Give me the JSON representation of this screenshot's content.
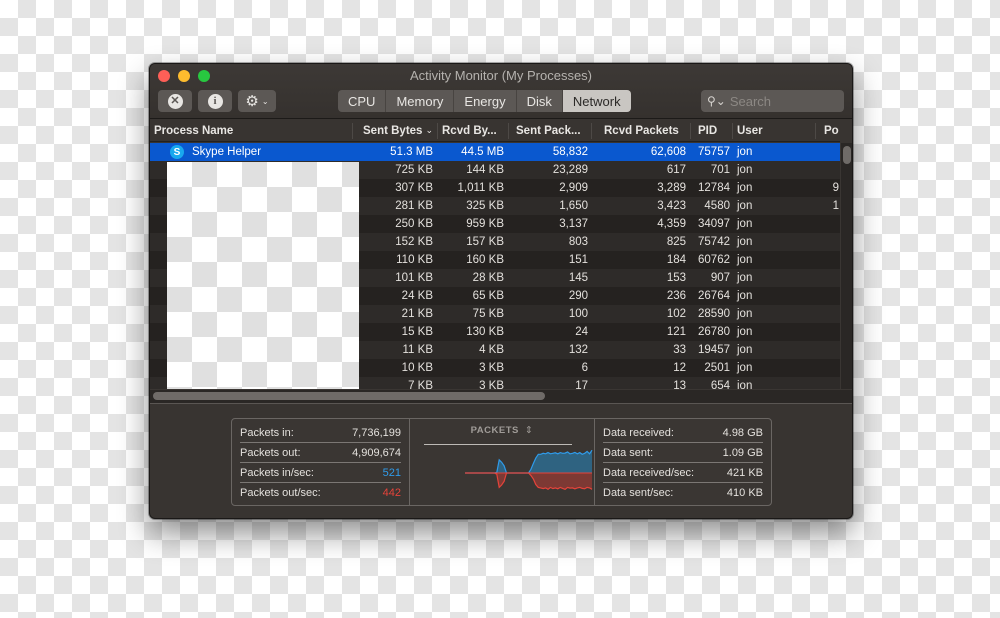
{
  "window": {
    "title": "Activity Monitor (My Processes)"
  },
  "toolbar": {
    "stop_icon": "stop-process-icon",
    "info_icon": "info-icon",
    "gear_icon": "gear-icon",
    "tabs": [
      {
        "label": "CPU",
        "active": false
      },
      {
        "label": "Memory",
        "active": false
      },
      {
        "label": "Energy",
        "active": false
      },
      {
        "label": "Disk",
        "active": false
      },
      {
        "label": "Network",
        "active": true
      }
    ],
    "search_placeholder": "Search",
    "search_value": ""
  },
  "table": {
    "columns": [
      "Process Name",
      "Sent Bytes",
      "Rcvd By...",
      "Sent Pack...",
      "Rcvd Packets",
      "PID",
      "User",
      "Po"
    ],
    "sort_column": "Sent Bytes",
    "sort_direction": "descending",
    "rows": [
      {
        "name": "Skype Helper",
        "icon": "skype-icon",
        "sent_bytes": "51.3 MB",
        "rcvd_bytes": "44.5 MB",
        "sent_packets": "58,832",
        "rcvd_packets": "62,608",
        "pid": "75757",
        "user": "jon",
        "po": "",
        "selected": true
      },
      {
        "name": "",
        "sent_bytes": "725 KB",
        "rcvd_bytes": "144 KB",
        "sent_packets": "23,289",
        "rcvd_packets": "617",
        "pid": "701",
        "user": "jon",
        "po": ""
      },
      {
        "name": "",
        "sent_bytes": "307 KB",
        "rcvd_bytes": "1,011 KB",
        "sent_packets": "2,909",
        "rcvd_packets": "3,289",
        "pid": "12784",
        "user": "jon",
        "po": "9"
      },
      {
        "name": "",
        "sent_bytes": "281 KB",
        "rcvd_bytes": "325 KB",
        "sent_packets": "1,650",
        "rcvd_packets": "3,423",
        "pid": "4580",
        "user": "jon",
        "po": "1"
      },
      {
        "name": "",
        "sent_bytes": "250 KB",
        "rcvd_bytes": "959 KB",
        "sent_packets": "3,137",
        "rcvd_packets": "4,359",
        "pid": "34097",
        "user": "jon",
        "po": ""
      },
      {
        "name": "",
        "sent_bytes": "152 KB",
        "rcvd_bytes": "157 KB",
        "sent_packets": "803",
        "rcvd_packets": "825",
        "pid": "75742",
        "user": "jon",
        "po": ""
      },
      {
        "name": "",
        "sent_bytes": "110 KB",
        "rcvd_bytes": "160 KB",
        "sent_packets": "151",
        "rcvd_packets": "184",
        "pid": "60762",
        "user": "jon",
        "po": ""
      },
      {
        "name": "",
        "sent_bytes": "101 KB",
        "rcvd_bytes": "28 KB",
        "sent_packets": "145",
        "rcvd_packets": "153",
        "pid": "907",
        "user": "jon",
        "po": ""
      },
      {
        "name": "",
        "sent_bytes": "24 KB",
        "rcvd_bytes": "65 KB",
        "sent_packets": "290",
        "rcvd_packets": "236",
        "pid": "26764",
        "user": "jon",
        "po": ""
      },
      {
        "name": "",
        "sent_bytes": "21 KB",
        "rcvd_bytes": "75 KB",
        "sent_packets": "100",
        "rcvd_packets": "102",
        "pid": "28590",
        "user": "jon",
        "po": ""
      },
      {
        "name": "",
        "sent_bytes": "15 KB",
        "rcvd_bytes": "130 KB",
        "sent_packets": "24",
        "rcvd_packets": "121",
        "pid": "26780",
        "user": "jon",
        "po": ""
      },
      {
        "name": "",
        "sent_bytes": "11 KB",
        "rcvd_bytes": "4 KB",
        "sent_packets": "132",
        "rcvd_packets": "33",
        "pid": "19457",
        "user": "jon",
        "po": ""
      },
      {
        "name": "",
        "sent_bytes": "10 KB",
        "rcvd_bytes": "3 KB",
        "sent_packets": "6",
        "rcvd_packets": "12",
        "pid": "2501",
        "user": "jon",
        "po": ""
      },
      {
        "name": "",
        "sent_bytes": "7 KB",
        "rcvd_bytes": "3 KB",
        "sent_packets": "17",
        "rcvd_packets": "13",
        "pid": "654",
        "user": "jon",
        "po": ""
      }
    ]
  },
  "summary": {
    "left": [
      {
        "label": "Packets in:",
        "value": "7,736,199"
      },
      {
        "label": "Packets out:",
        "value": "4,909,674"
      },
      {
        "label": "Packets in/sec:",
        "value": "521",
        "color": "#2f9bea"
      },
      {
        "label": "Packets out/sec:",
        "value": "442",
        "color": "#e5433a"
      }
    ],
    "chart": {
      "title": "PACKETS",
      "selector_icon": "updown-chevron-icon",
      "in_color": "#2f9bea",
      "out_color": "#e5433a",
      "in_series": [
        0,
        0,
        0,
        0,
        0,
        0,
        0,
        0,
        0,
        0,
        0,
        0,
        0,
        0.02,
        0.55,
        0.45,
        0.3,
        0,
        0,
        0,
        0,
        0,
        0,
        0,
        0,
        0,
        0,
        0.15,
        0.4,
        0.62,
        0.78,
        0.78,
        0.82,
        0.8,
        0.85,
        0.8,
        0.82,
        0.84,
        0.8,
        0.85,
        0.82,
        0.83,
        0.88,
        0.8,
        0.82,
        0.86,
        0.8,
        0.85,
        0.78,
        0.82,
        0.9,
        0.8,
        0.95
      ],
      "out_series": [
        0,
        0,
        0,
        0,
        0,
        0,
        0,
        0,
        0,
        0,
        0,
        0,
        0,
        0.05,
        0.6,
        0.5,
        0.35,
        0,
        0,
        0,
        0,
        0,
        0,
        0,
        0,
        0,
        0,
        0.1,
        0.25,
        0.48,
        0.6,
        0.62,
        0.65,
        0.62,
        0.68,
        0.6,
        0.65,
        0.62,
        0.66,
        0.6,
        0.64,
        0.68,
        0.6,
        0.63,
        0.62,
        0.66,
        0.62,
        0.6,
        0.64,
        0.66,
        0.6,
        0.62,
        0.68
      ]
    },
    "right": [
      {
        "label": "Data received:",
        "value": "4.98 GB"
      },
      {
        "label": "Data sent:",
        "value": "1.09 GB"
      },
      {
        "label": "Data received/sec:",
        "value": "421 KB"
      },
      {
        "label": "Data sent/sec:",
        "value": "410 KB"
      }
    ]
  }
}
